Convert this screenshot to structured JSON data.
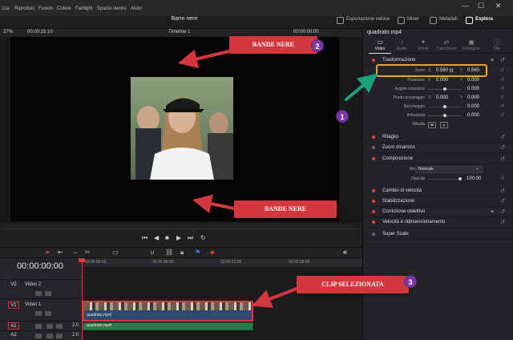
{
  "menu": {
    "items": [
      "zza",
      "Riproduci",
      "Fusion",
      "Colore",
      "Fairlight",
      "Spazio lavoro",
      "Aiuto"
    ]
  },
  "window": {
    "minimize": "—",
    "maximize": "☐",
    "close": "✕"
  },
  "project": {
    "title": "Barre nere"
  },
  "top_buttons": {
    "export": "Esportazione veloce",
    "mixer": "Mixer",
    "metadata": "Metadati",
    "explore": "Esplora"
  },
  "viewer": {
    "zoom": "27%",
    "source_tc": "00:00:15:10",
    "timeline_name": "Timeline 1",
    "record_tc": "00:00:00:00"
  },
  "timeline": {
    "timecode": "00:00:00:00",
    "ruler": [
      "00:00:00:00",
      "00:00:06:00",
      "00:00:12:00",
      "00:00:18:00"
    ],
    "tracks": [
      {
        "id": "V2",
        "name": "Video 2",
        "selected": false
      },
      {
        "id": "V1",
        "name": "Video 1",
        "selected": true
      },
      {
        "id": "A1",
        "name": "",
        "selected": true,
        "level": "2.0"
      },
      {
        "id": "A2",
        "name": "",
        "selected": false,
        "level": "2.0"
      }
    ],
    "video_clip": "quadrato.mp4",
    "audio_clip": "quadrato.mp4"
  },
  "inspector": {
    "clip_name": "quadrato.mp4",
    "tabs": [
      {
        "label": "Video",
        "icon": "▭",
        "active": true
      },
      {
        "label": "Audio",
        "icon": "♪",
        "active": false
      },
      {
        "label": "Effetti",
        "icon": "✦",
        "active": false
      },
      {
        "label": "Transizione",
        "icon": "⇄",
        "active": false
      },
      {
        "label": "Immagine",
        "icon": "▣",
        "active": false
      },
      {
        "label": "File",
        "icon": "ⓘ",
        "active": false
      }
    ],
    "transform": {
      "header": "Trasformazione",
      "zoom_label": "Zoom",
      "zoom_x": "0.560",
      "zoom_y": "0.560",
      "position_label": "Posizione",
      "pos_x": "0.000",
      "pos_y": "0.000",
      "rotation_label": "Angolo rotazione",
      "rotation": "0.000",
      "anchor_label": "Punto ancoraggio",
      "anchor_x": "0.000",
      "anchor_y": "0.000",
      "pitch_label": "Beccheggio",
      "pitch": "0.000",
      "yaw_label": "Imbardata",
      "yaw": "0.000",
      "flip_label": "Ribalta"
    },
    "sections_mid": {
      "crop": "Ritaglio",
      "dynamic_zoom": "Zoom dinamico",
      "composite": "Composizione",
      "mode_label": "Modalità",
      "mode_value": "Normale",
      "opacity_label": "Opacità",
      "opacity_value": "100.00"
    },
    "sections_low": {
      "speed": "Cambio di velocità",
      "stabilization": "Stabilizzazione",
      "lens": "Correzione obiettivo",
      "retime": "Velocità e ridimensionamento",
      "super_scale": "Super Scale"
    }
  },
  "annotations": {
    "top_callout": "BANDE NERE",
    "bottom_callout": "BANDE NERE",
    "clip_callout": "CLIP SELEZIONATA",
    "badge_1": "1",
    "badge_2": "2",
    "badge_3": "3",
    "colors": {
      "callout": "#d5373f",
      "badge": "#7b3aa3",
      "arrow": "#1aa37a",
      "highlight": "#e8a33a"
    }
  }
}
